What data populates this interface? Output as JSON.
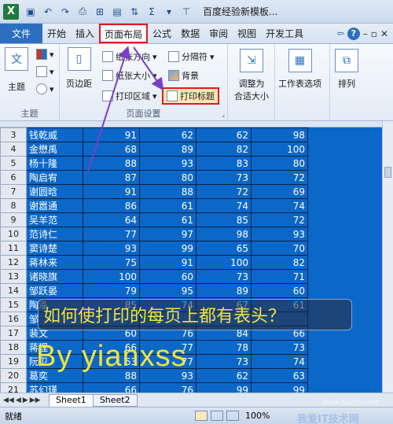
{
  "window": {
    "title": "百度经验新模板..."
  },
  "ribbon_tabs": [
    {
      "label": "文件"
    },
    {
      "label": "开始"
    },
    {
      "label": "插入"
    },
    {
      "label": "页面布局"
    },
    {
      "label": "公式"
    },
    {
      "label": "数据"
    },
    {
      "label": "审阅"
    },
    {
      "label": "视图"
    },
    {
      "label": "开发工具"
    }
  ],
  "ribbon": {
    "theme_group": {
      "button": "主题",
      "label": "主题"
    },
    "page_setup": {
      "margins": "页边距",
      "orientation": "纸张方向",
      "size": "纸张大小",
      "print_area": "打印区域",
      "breaks": "分隔符",
      "background": "背景",
      "print_titles": "打印标题",
      "label": "页面设置"
    },
    "fit": {
      "label1": "调整为",
      "label2": "合适大小"
    },
    "sheet_options": "工作表选项",
    "arrange": "排列"
  },
  "table": {
    "rows": [
      {
        "n": "3",
        "name": "钱乾威",
        "a": "91",
        "b": "62",
        "c": "62",
        "d": "98"
      },
      {
        "n": "4",
        "name": "金懋禹",
        "a": "68",
        "b": "89",
        "c": "82",
        "d": "100"
      },
      {
        "n": "5",
        "name": "杨十隆",
        "a": "88",
        "b": "93",
        "c": "83",
        "d": "80"
      },
      {
        "n": "6",
        "name": "陶启宥",
        "a": "87",
        "b": "80",
        "c": "73",
        "d": "72"
      },
      {
        "n": "7",
        "name": "谢圆晗",
        "a": "91",
        "b": "88",
        "c": "72",
        "d": "69"
      },
      {
        "n": "8",
        "name": "谢嚣通",
        "a": "86",
        "b": "61",
        "c": "74",
        "d": "74"
      },
      {
        "n": "9",
        "name": "吴羊范",
        "a": "64",
        "b": "61",
        "c": "85",
        "d": "72"
      },
      {
        "n": "10",
        "name": "范诗仁",
        "a": "77",
        "b": "97",
        "c": "98",
        "d": "93"
      },
      {
        "n": "11",
        "name": "窦诗楚",
        "a": "93",
        "b": "99",
        "c": "65",
        "d": "70"
      },
      {
        "n": "12",
        "name": "蒋林来",
        "a": "75",
        "b": "91",
        "c": "100",
        "d": "82"
      },
      {
        "n": "13",
        "name": "诸晓旗",
        "a": "100",
        "b": "60",
        "c": "73",
        "d": "71"
      },
      {
        "n": "14",
        "name": "邹跃晏",
        "a": "79",
        "b": "95",
        "c": "89",
        "d": "60"
      },
      {
        "n": "15",
        "name": "陶泓",
        "a": "85",
        "b": "74",
        "c": "67",
        "d": "61"
      },
      {
        "n": "16",
        "name": "邹",
        "a": "",
        "b": "",
        "c": "",
        "d": ""
      },
      {
        "n": "17",
        "name": "裴文",
        "a": "60",
        "b": "76",
        "c": "84",
        "d": "66"
      },
      {
        "n": "18",
        "name": "蒋理",
        "a": "66",
        "b": "77",
        "c": "78",
        "d": "73"
      },
      {
        "n": "19",
        "name": "阮卫",
        "a": "63",
        "b": "77",
        "c": "73",
        "d": "74"
      },
      {
        "n": "20",
        "name": "葛奕",
        "a": "88",
        "b": "93",
        "c": "62",
        "d": "63"
      },
      {
        "n": "21",
        "name": "苏幻瑾",
        "a": "66",
        "b": "76",
        "c": "99",
        "d": "99"
      }
    ]
  },
  "sheet_tabs": [
    "Sheet1",
    "Sheet2"
  ],
  "status": {
    "ready": "就绪",
    "zoom": "100%"
  },
  "overlay": {
    "question": "如何使打印的每页上都有表头？",
    "byline": "By yianxss",
    "watermark": "我爱IT技术网",
    "watermark_url": "www.52itjs.com"
  },
  "colors": {
    "selection": "#0c68c8",
    "highlight": "#e0191e",
    "arrow": "#7b3fc4",
    "overlay_text": "#f2e33a"
  }
}
